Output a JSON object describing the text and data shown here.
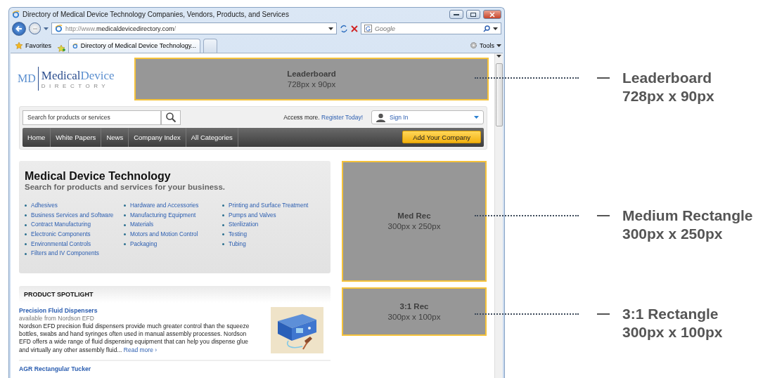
{
  "window": {
    "title": "Directory of Medical Device Technology Companies, Vendors, Products, and Services"
  },
  "address_bar": {
    "url_prefix": "http://www.",
    "url_domain": "medicaldevicedirectory.com",
    "url_suffix": "/"
  },
  "search_box": {
    "placeholder": "Google"
  },
  "favorites": {
    "label": "Favorites"
  },
  "tabs": [
    {
      "label": "Directory of Medical Device Technology...",
      "selected": true
    }
  ],
  "tools": {
    "label": "Tools"
  },
  "site": {
    "logo": {
      "mark": "MD",
      "name_1": "Medical",
      "name_2": "Device",
      "tagline": "DIRECTORY"
    },
    "search": {
      "placeholder": "Search for products or services"
    },
    "access": {
      "text": "Access more.",
      "link": "Register Today!"
    },
    "sign_in": {
      "label": "Sign In"
    },
    "nav": [
      {
        "label": "Home"
      },
      {
        "label": "White Papers"
      },
      {
        "label": "News"
      },
      {
        "label": "Company Index"
      },
      {
        "label": "All Categories"
      }
    ],
    "add_company": {
      "label": "Add Your Company"
    },
    "hero": {
      "title": "Medical Device Technology",
      "subtitle": "Search for products and services for your business.",
      "columns": [
        [
          "Adhesives",
          "Business Services and Software",
          "Contract Manufacturing",
          "Electronic Components",
          "Environmental Controls",
          "Filters and IV Components"
        ],
        [
          "Hardware and Accessories",
          "Manufacturing Equipment",
          "Materials",
          "Motors and Motion Control",
          "Packaging"
        ],
        [
          "Printing and Surface Treatment",
          "Pumps and Valves",
          "Sterilization",
          "Testing",
          "Tubing"
        ]
      ]
    },
    "spotlight": {
      "heading": "PRODUCT SPOTLIGHT",
      "items": [
        {
          "title": "Precision Fluid Dispensers",
          "source": "available from Nordson EFD",
          "body": "Nordson EFD precision fluid dispensers provide much greater control than the squeeze bottles, swabs and hand syringes often used in manual assembly processes. Nordson EFD offers a wide range of fluid dispensing equipment that can help you dispense glue and virtually any other assembly fluid...",
          "link": "Read more ›",
          "kind": "picture"
        },
        {
          "title": "AGR Rectangular Tucker"
        }
      ]
    },
    "ads": [
      {
        "title": "Leaderboard",
        "size": "728px x 90px"
      },
      {
        "title": "Med Rec",
        "size": "300px x 250px"
      },
      {
        "title": "3:1 Rec",
        "size": "300px x 100px"
      }
    ]
  },
  "annotations": [
    {
      "title": "Leaderboard",
      "size": "728px x 90px"
    },
    {
      "title": "Medium Rectangle",
      "size": "300px x 250px"
    },
    {
      "title": "3:1 Rectangle",
      "size": "300px x 100px"
    }
  ]
}
